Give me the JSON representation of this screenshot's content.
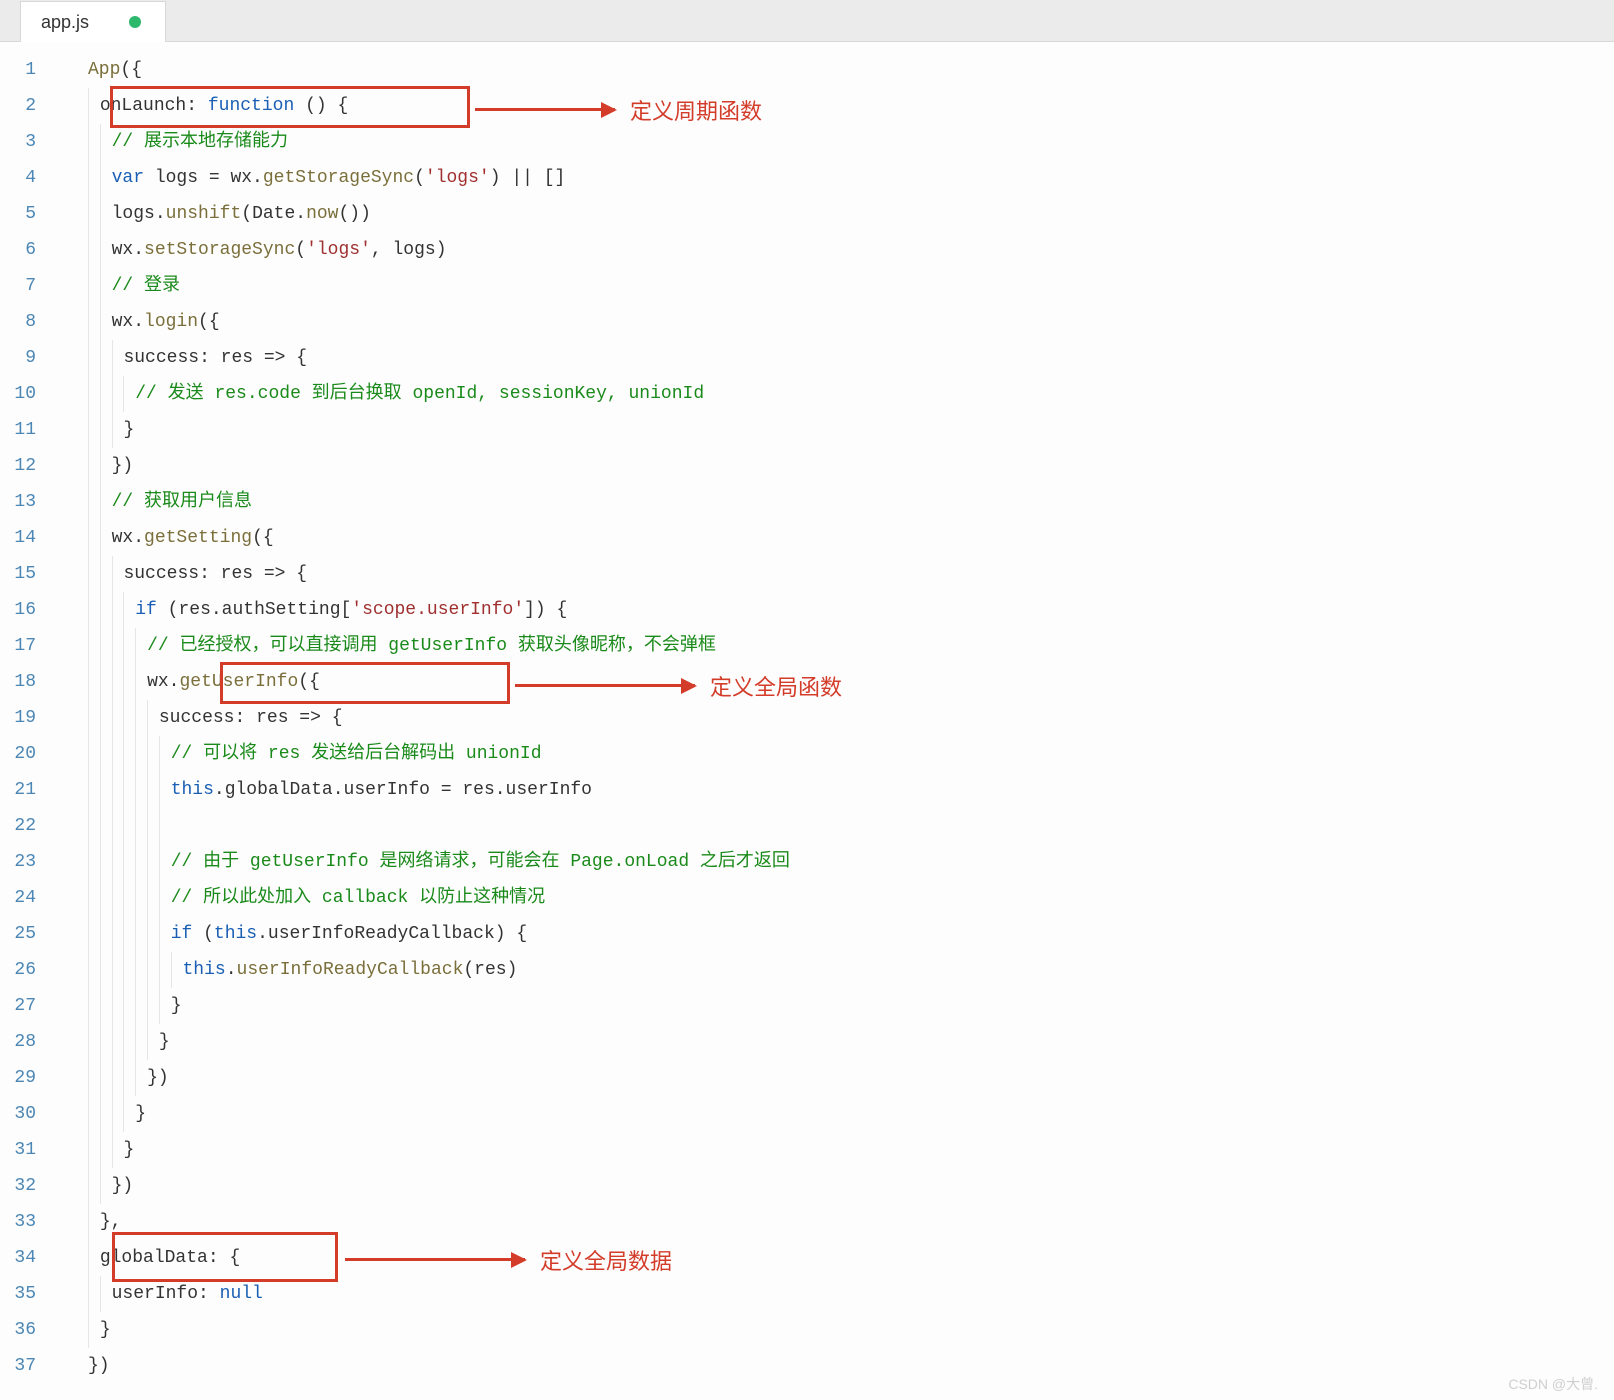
{
  "tab": {
    "filename": "app.js",
    "modified": true
  },
  "annotations": {
    "a1": "定义周期函数",
    "a2": "定义全局函数",
    "a3": "定义全局数据"
  },
  "watermark": "CSDN @大曾.",
  "colors": {
    "highlight_border": "#d43c2a",
    "comment": "#1a8a1a",
    "keyword": "#1a5fb4",
    "string": "#a03030",
    "tab_dot": "#2eb86c"
  },
  "file_content": {
    "language": "javascript",
    "full_text": "App({\n  onLaunch: function () {\n    // 展示本地存储能力\n    var logs = wx.getStorageSync('logs') || []\n    logs.unshift(Date.now())\n    wx.setStorageSync('logs', logs)\n    // 登录\n    wx.login({\n      success: res => {\n        // 发送 res.code 到后台换取 openId, sessionKey, unionId\n      }\n    })\n    // 获取用户信息\n    wx.getSetting({\n      success: res => {\n        if (res.authSetting['scope.userInfo']) {\n          // 已经授权，可以直接调用 getUserInfo 获取头像昵称，不会弹框\n          wx.getUserInfo({\n            success: res => {\n              // 可以将 res 发送给后台解码出 unionId\n              this.globalData.userInfo = res.userInfo\n\n              // 由于 getUserInfo 是网络请求，可能会在 Page.onLoad 之后才返回\n              // 所以此处加入 callback 以防止这种情况\n              if (this.userInfoReadyCallback) {\n                this.userInfoReadyCallback(res)\n              }\n            }\n          })\n        }\n      }\n    })\n  },\n  globalData: {\n    userInfo: null\n  }\n})"
  },
  "lines": [
    {
      "n": 1,
      "indent": 0,
      "tokens": [
        [
          "fn",
          "App"
        ],
        [
          "pr",
          "({"
        ]
      ]
    },
    {
      "n": 2,
      "indent": 1,
      "tokens": [
        [
          "id",
          "onLaunch"
        ],
        [
          "pr",
          ": "
        ],
        [
          "kw",
          "function"
        ],
        [
          "pr",
          " () {"
        ]
      ]
    },
    {
      "n": 3,
      "indent": 2,
      "tokens": [
        [
          "cm",
          "// 展示本地存储能力"
        ]
      ]
    },
    {
      "n": 4,
      "indent": 2,
      "tokens": [
        [
          "kw",
          "var"
        ],
        [
          "pr",
          " logs = wx."
        ],
        [
          "fn",
          "getStorageSync"
        ],
        [
          "pr",
          "("
        ],
        [
          "st",
          "'logs'"
        ],
        [
          "pr",
          ") || []"
        ]
      ]
    },
    {
      "n": 5,
      "indent": 2,
      "tokens": [
        [
          "pr",
          "logs."
        ],
        [
          "fn",
          "unshift"
        ],
        [
          "pr",
          "(Date."
        ],
        [
          "fn",
          "now"
        ],
        [
          "pr",
          "())"
        ]
      ]
    },
    {
      "n": 6,
      "indent": 2,
      "tokens": [
        [
          "pr",
          "wx."
        ],
        [
          "fn",
          "setStorageSync"
        ],
        [
          "pr",
          "("
        ],
        [
          "st",
          "'logs'"
        ],
        [
          "pr",
          ", logs)"
        ]
      ]
    },
    {
      "n": 7,
      "indent": 2,
      "tokens": [
        [
          "cm",
          "// 登录"
        ]
      ]
    },
    {
      "n": 8,
      "indent": 2,
      "tokens": [
        [
          "pr",
          "wx."
        ],
        [
          "fn",
          "login"
        ],
        [
          "pr",
          "({"
        ]
      ]
    },
    {
      "n": 9,
      "indent": 3,
      "tokens": [
        [
          "id",
          "success"
        ],
        [
          "pr",
          ": res => {"
        ]
      ]
    },
    {
      "n": 10,
      "indent": 4,
      "tokens": [
        [
          "cm",
          "// 发送 res.code 到后台换取 openId, sessionKey, unionId"
        ]
      ]
    },
    {
      "n": 11,
      "indent": 3,
      "tokens": [
        [
          "pr",
          "}"
        ]
      ]
    },
    {
      "n": 12,
      "indent": 2,
      "tokens": [
        [
          "pr",
          "})"
        ]
      ]
    },
    {
      "n": 13,
      "indent": 2,
      "tokens": [
        [
          "cm",
          "// 获取用户信息"
        ]
      ]
    },
    {
      "n": 14,
      "indent": 2,
      "tokens": [
        [
          "pr",
          "wx."
        ],
        [
          "fn",
          "getSetting"
        ],
        [
          "pr",
          "({"
        ]
      ]
    },
    {
      "n": 15,
      "indent": 3,
      "tokens": [
        [
          "id",
          "success"
        ],
        [
          "pr",
          ": res => {"
        ]
      ]
    },
    {
      "n": 16,
      "indent": 4,
      "tokens": [
        [
          "kw",
          "if"
        ],
        [
          "pr",
          " (res.authSetting["
        ],
        [
          "st",
          "'scope.userInfo'"
        ],
        [
          "pr",
          "]) {"
        ]
      ]
    },
    {
      "n": 17,
      "indent": 5,
      "tokens": [
        [
          "cm",
          "// 已经授权，可以直接调用 getUserInfo 获取头像昵称，不会弹框"
        ]
      ]
    },
    {
      "n": 18,
      "indent": 5,
      "tokens": [
        [
          "pr",
          "wx."
        ],
        [
          "fn",
          "getUserInfo"
        ],
        [
          "pr",
          "({"
        ]
      ]
    },
    {
      "n": 19,
      "indent": 6,
      "tokens": [
        [
          "id",
          "success"
        ],
        [
          "pr",
          ": res => {"
        ]
      ]
    },
    {
      "n": 20,
      "indent": 7,
      "tokens": [
        [
          "cm",
          "// 可以将 res 发送给后台解码出 unionId"
        ]
      ]
    },
    {
      "n": 21,
      "indent": 7,
      "tokens": [
        [
          "th",
          "this"
        ],
        [
          "pr",
          ".globalData.userInfo = res.userInfo"
        ]
      ]
    },
    {
      "n": 22,
      "indent": 7,
      "tokens": []
    },
    {
      "n": 23,
      "indent": 7,
      "tokens": [
        [
          "cm",
          "// 由于 getUserInfo 是网络请求，可能会在 Page.onLoad 之后才返回"
        ]
      ]
    },
    {
      "n": 24,
      "indent": 7,
      "tokens": [
        [
          "cm",
          "// 所以此处加入 callback 以防止这种情况"
        ]
      ]
    },
    {
      "n": 25,
      "indent": 7,
      "tokens": [
        [
          "kw",
          "if"
        ],
        [
          "pr",
          " ("
        ],
        [
          "th",
          "this"
        ],
        [
          "pr",
          ".userInfoReadyCallback) {"
        ]
      ]
    },
    {
      "n": 26,
      "indent": 8,
      "tokens": [
        [
          "th",
          "this"
        ],
        [
          "pr",
          "."
        ],
        [
          "fn",
          "userInfoReadyCallback"
        ],
        [
          "pr",
          "(res)"
        ]
      ]
    },
    {
      "n": 27,
      "indent": 7,
      "tokens": [
        [
          "pr",
          "}"
        ]
      ]
    },
    {
      "n": 28,
      "indent": 6,
      "tokens": [
        [
          "pr",
          "}"
        ]
      ]
    },
    {
      "n": 29,
      "indent": 5,
      "tokens": [
        [
          "pr",
          "})"
        ]
      ]
    },
    {
      "n": 30,
      "indent": 4,
      "tokens": [
        [
          "pr",
          "}"
        ]
      ]
    },
    {
      "n": 31,
      "indent": 3,
      "tokens": [
        [
          "pr",
          "}"
        ]
      ]
    },
    {
      "n": 32,
      "indent": 2,
      "tokens": [
        [
          "pr",
          "})"
        ]
      ]
    },
    {
      "n": 33,
      "indent": 1,
      "tokens": [
        [
          "pr",
          "},"
        ]
      ]
    },
    {
      "n": 34,
      "indent": 1,
      "tokens": [
        [
          "id",
          "globalData"
        ],
        [
          "pr",
          ": {"
        ]
      ]
    },
    {
      "n": 35,
      "indent": 2,
      "tokens": [
        [
          "id",
          "userInfo"
        ],
        [
          "pr",
          ": "
        ],
        [
          "nl",
          "null"
        ]
      ]
    },
    {
      "n": 36,
      "indent": 1,
      "tokens": [
        [
          "pr",
          "}"
        ]
      ]
    },
    {
      "n": 37,
      "indent": 0,
      "tokens": [
        [
          "pr",
          "})"
        ]
      ]
    }
  ]
}
